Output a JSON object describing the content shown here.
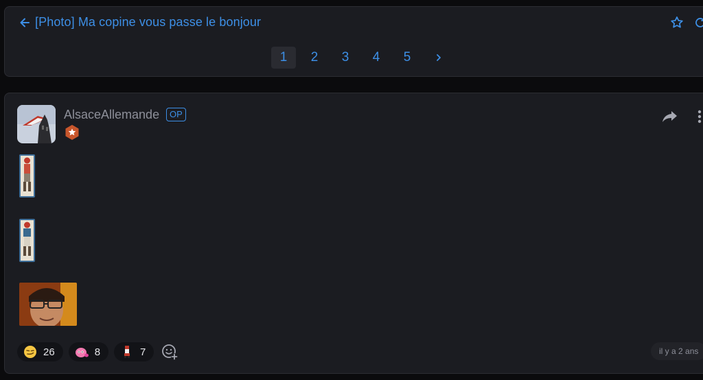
{
  "topic": {
    "title": "[Photo] Ma copine vous passe le bonjour",
    "icons": [
      "back-arrow-icon",
      "star-icon",
      "refresh-icon"
    ],
    "pagination": {
      "pages": [
        "1",
        "2",
        "3",
        "4",
        "5"
      ],
      "current": "1",
      "next_icon": "chevron-right-icon"
    }
  },
  "post": {
    "author": "AlsaceAllemande",
    "op_label": "OP",
    "rank_icon": "star-hexagon-badge-icon",
    "action_icons": [
      "share-icon",
      "more-vertical-icon"
    ],
    "reactions": [
      {
        "icon": "smirk-emoji-icon",
        "count": "26"
      },
      {
        "icon": "pink-blob-emoji-icon",
        "count": "8"
      },
      {
        "icon": "mini-character-emoji-icon",
        "count": "7"
      }
    ],
    "add_reaction_icon": "add-reaction-icon",
    "timestamp": "il y a 2 ans"
  },
  "colors": {
    "page_bg": "#0b0b0d",
    "card_bg": "#1b1c21",
    "accent": "#3d8fe6",
    "muted_text": "#8d8f99",
    "rank_badge": "#c8562c"
  }
}
